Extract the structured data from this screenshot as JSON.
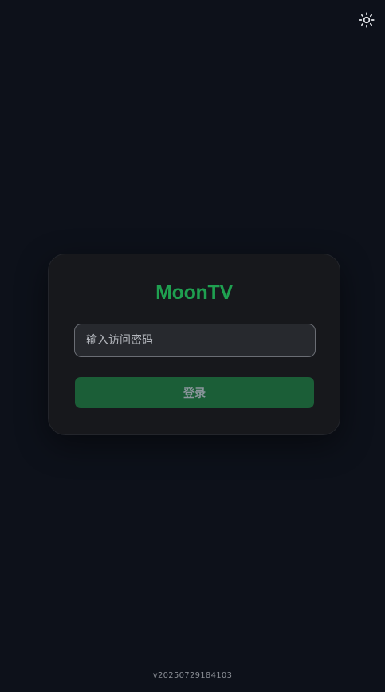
{
  "header": {
    "theme_toggle_icon": "sun-icon"
  },
  "login": {
    "brand": "MoonTV",
    "password_placeholder": "输入访问密码",
    "password_value": "",
    "submit_label": "登录"
  },
  "footer": {
    "version": "v20250729184103"
  },
  "colors": {
    "background": "#0d111a",
    "card": "#17181c",
    "brand_green": "#1fa050",
    "button_bg": "#1b5e37"
  }
}
